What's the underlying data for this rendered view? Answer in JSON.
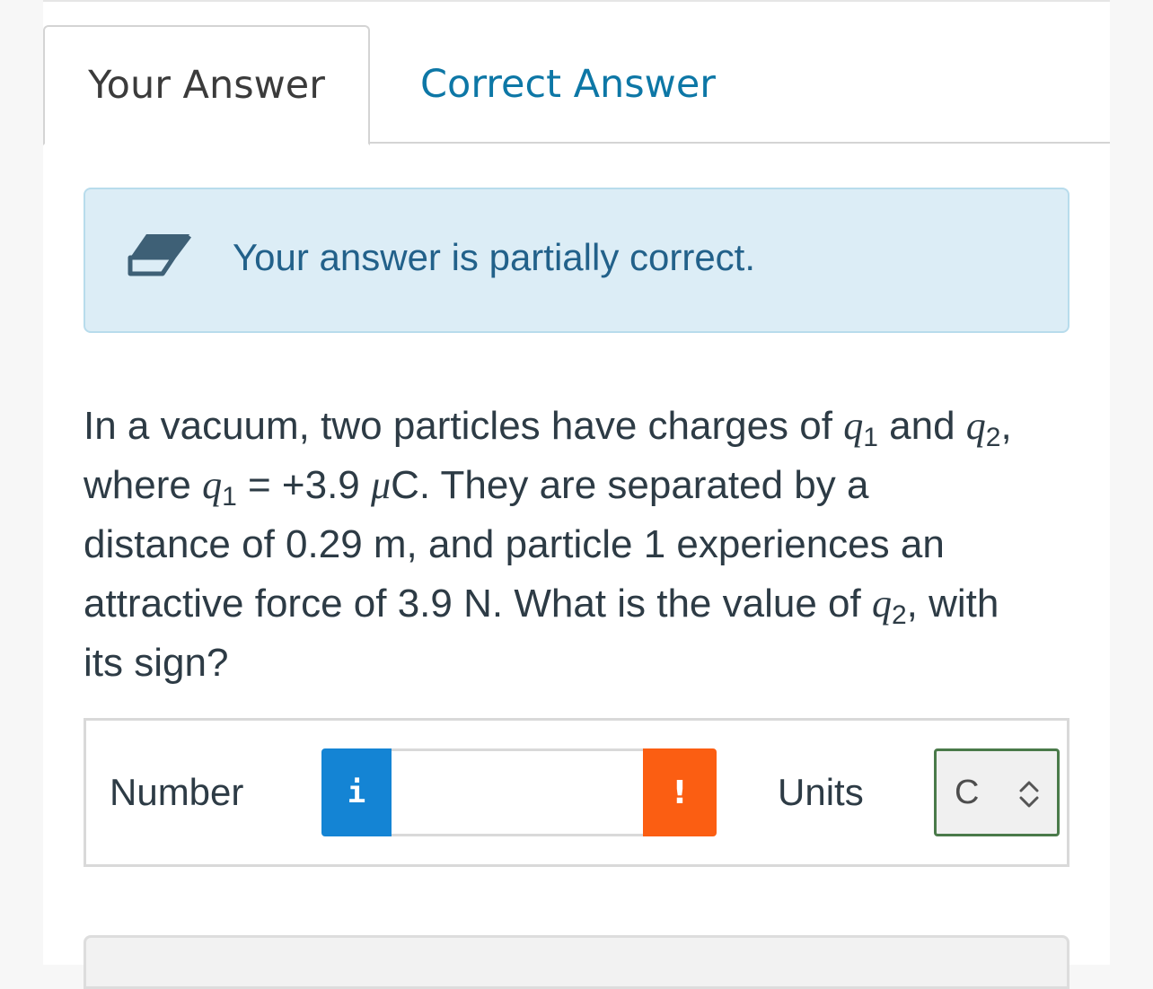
{
  "tabs": {
    "your_answer": "Your Answer",
    "correct_answer": "Correct Answer"
  },
  "alert": {
    "icon": "eraser-icon",
    "message": "Your answer is partially correct."
  },
  "question": {
    "line1": {
      "before": "In a vacuum, two particles have charges of ",
      "var1": "q",
      "sub1": "1",
      "mid": " and ",
      "var2": "q",
      "sub2": "2",
      "after": ","
    },
    "line2": {
      "before": "where ",
      "var": "q",
      "sub": "1",
      "eq": " = +3.9 ",
      "mu": "μ",
      "after": "C. They are separated by a"
    },
    "line3": "distance of 0.29 m, and particle 1 experiences an",
    "line4": {
      "before": "attractive force of 3.9 N. What is the value of ",
      "var": "q",
      "sub": "2",
      "after": ", with"
    },
    "line5": "its sign?"
  },
  "answer": {
    "number_label": "Number",
    "info_glyph": "i",
    "number_value": "",
    "warning_glyph": "!",
    "units_label": "Units",
    "units_value": "C"
  },
  "colors": {
    "link_blue": "#0d77a6",
    "alert_bg": "#dcedf6",
    "info_blue": "#1484d4",
    "warning_orange": "#fb5e12",
    "select_border_green": "#4a7a4a"
  }
}
